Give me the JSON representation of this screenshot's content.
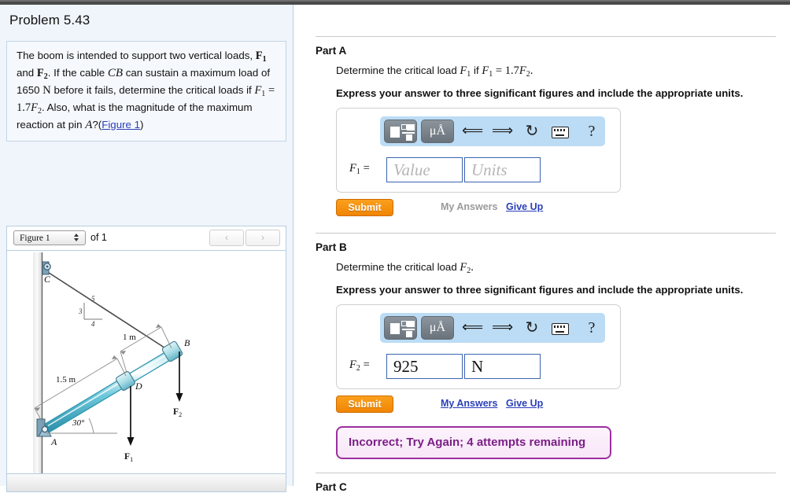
{
  "problem": {
    "title": "Problem 5.43",
    "statement_html": "The boom is intended to support two vertical loads, <b>F</b><sub>1</sub> and <b>F</b><sub>2</sub>. If the cable <i>CB</i> can sustain a maximum load of 1650 N before it fails, determine the critical loads if F<sub>1</sub> = 1.7F<sub>2</sub>. Also, what is the magnitude of the maximum reaction at pin <i>A</i>?",
    "figure_link": "Figure 1",
    "cable_label": "CB",
    "max_cable_load": "1650 N",
    "relation": "F1 = 1.7F2",
    "pin_label": "A"
  },
  "figure_panel": {
    "select_value": "Figure 1",
    "of_label": "of 1",
    "prev_label": "‹",
    "next_label": "›"
  },
  "figure": {
    "points": {
      "A": "A",
      "B": "B",
      "C": "C",
      "D": "D"
    },
    "dim_long": "1.5 m",
    "dim_short": "1 m",
    "angle": "30°",
    "slope_rise": "3",
    "slope_run": "4",
    "slope_hyp": "5",
    "load_1": "F1",
    "load_2": "F2"
  },
  "parts": [
    {
      "heading": "Part A",
      "question_pre": "Determine the critical load ",
      "question_var": "F1",
      "question_mid": " if ",
      "question_eq": "F1 = 1.7F2.",
      "instruction": "Express your answer to three significant figures and include the appropriate units.",
      "field_label": "F1 =",
      "value": "",
      "value_placeholder": "Value",
      "units": "",
      "units_placeholder": "Units",
      "submit_label": "Submit",
      "my_answers_label": "My Answers",
      "my_answers_enabled": false,
      "give_up_label": "Give Up",
      "feedback": null
    },
    {
      "heading": "Part B",
      "question_pre": "Determine the critical load ",
      "question_var": "F2",
      "question_mid": "",
      "question_eq": ".",
      "instruction": "Express your answer to three significant figures and include the appropriate units.",
      "field_label": "F2 =",
      "value": "925",
      "value_placeholder": "Value",
      "units": "N",
      "units_placeholder": "Units",
      "submit_label": "Submit",
      "my_answers_label": "My Answers",
      "my_answers_enabled": true,
      "give_up_label": "Give Up",
      "feedback": "Incorrect; Try Again; 4 attempts remaining"
    },
    {
      "heading": "Part C"
    }
  ],
  "toolbar": {
    "template_icon": "math-template-icon",
    "units_label": "μÅ",
    "undo_icon": "↩",
    "redo_icon": "↪",
    "reset_icon": "↻",
    "keyboard_icon": "keyboard-icon",
    "help_label": "?"
  },
  "colors": {
    "accent_orange": "#f08504",
    "link_blue": "#2a3fb8",
    "feedback_purple": "#7a1f86",
    "toolbar_blue": "#bcdcf5",
    "panel_blue": "#f0f5fc"
  }
}
